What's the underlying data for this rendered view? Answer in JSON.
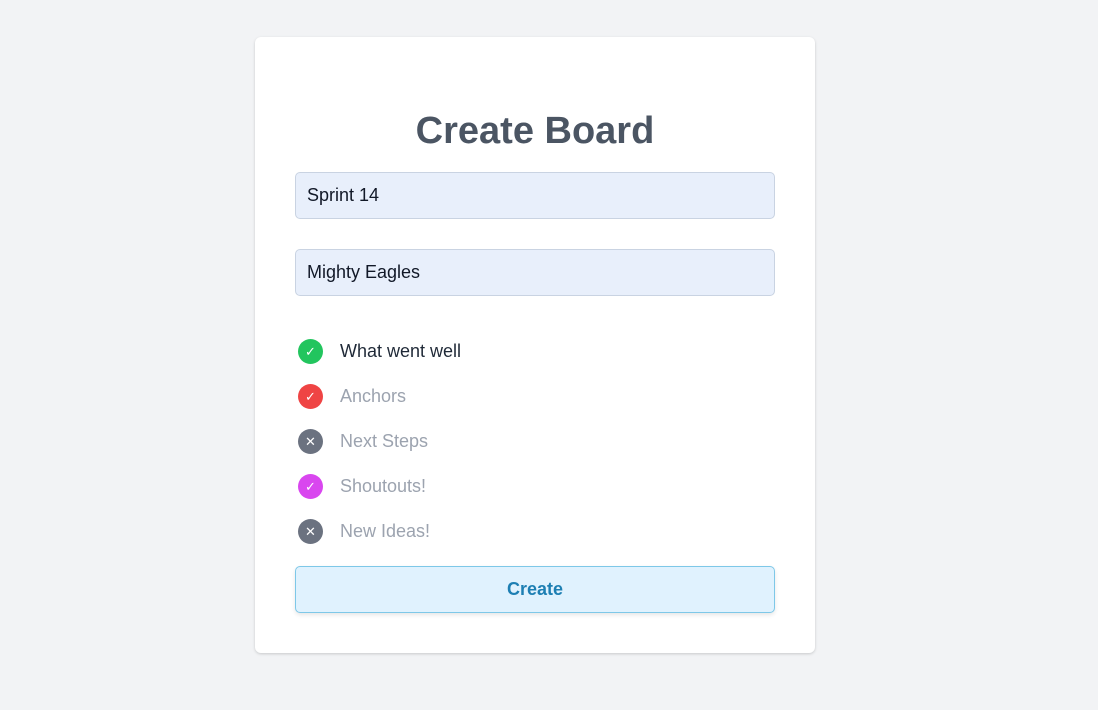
{
  "form": {
    "title": "Create Board",
    "board_name": {
      "value": "Sprint 14",
      "placeholder": ""
    },
    "team_name": {
      "value": "Mighty Eagles",
      "placeholder": ""
    },
    "columns": [
      {
        "label": "What went well",
        "selected": true,
        "icon": "check-icon",
        "color": "#22c55e"
      },
      {
        "label": "Anchors",
        "selected": true,
        "icon": "check-icon",
        "color": "#ef4444"
      },
      {
        "label": "Next Steps",
        "selected": false,
        "icon": "x-icon",
        "color": "#6b7280"
      },
      {
        "label": "Shoutouts!",
        "selected": true,
        "icon": "check-icon",
        "color": "#d946ef"
      },
      {
        "label": "New Ideas!",
        "selected": false,
        "icon": "x-icon",
        "color": "#6b7280"
      }
    ],
    "create_label": "Create"
  }
}
